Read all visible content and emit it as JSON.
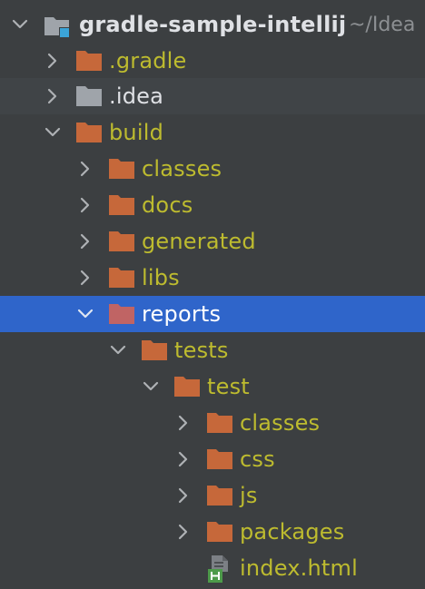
{
  "project": {
    "name": "gradle-sample-intellij",
    "path": "~/Idea"
  },
  "colors": {
    "background": "#3c3f41",
    "selection": "#2f65ca",
    "folder": "#c6683a",
    "folder_excluded": "#c06464",
    "folder_plain": "#9fa4aa",
    "excluded_text": "#bdbb2f",
    "plain_text": "#dfe1e5"
  },
  "tree": {
    "items": [
      {
        "label": ".gradle",
        "state": "collapsed",
        "icon": "folder-icon"
      },
      {
        "label": ".idea",
        "state": "collapsed",
        "icon": "folder-icon"
      },
      {
        "label": "build",
        "state": "expanded",
        "icon": "folder-icon"
      },
      {
        "label": "classes",
        "state": "collapsed",
        "icon": "folder-icon"
      },
      {
        "label": "docs",
        "state": "collapsed",
        "icon": "folder-icon"
      },
      {
        "label": "generated",
        "state": "collapsed",
        "icon": "folder-icon"
      },
      {
        "label": "libs",
        "state": "collapsed",
        "icon": "folder-icon"
      },
      {
        "label": "reports",
        "state": "expanded",
        "icon": "folder-icon",
        "selected": true
      },
      {
        "label": "tests",
        "state": "expanded",
        "icon": "folder-icon"
      },
      {
        "label": "test",
        "state": "expanded",
        "icon": "folder-icon"
      },
      {
        "label": "classes",
        "state": "collapsed",
        "icon": "folder-icon"
      },
      {
        "label": "css",
        "state": "collapsed",
        "icon": "folder-icon"
      },
      {
        "label": "js",
        "state": "collapsed",
        "icon": "folder-icon"
      },
      {
        "label": "packages",
        "state": "collapsed",
        "icon": "folder-icon"
      },
      {
        "label": "index.html",
        "state": "leaf",
        "icon": "html-file-icon"
      }
    ]
  }
}
